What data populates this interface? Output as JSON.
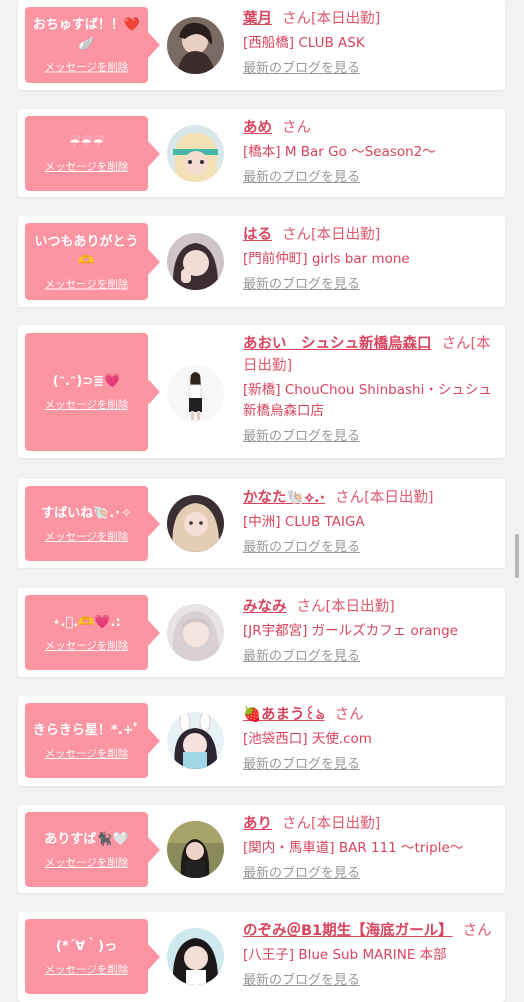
{
  "colors": {
    "accent": "#fc94a2",
    "name": "#d9445e",
    "link_gray": "#999999",
    "background": "#f2f2f2"
  },
  "delete_label": "メッセージを削除",
  "blog_label": "最新のブログを見る",
  "san_label": "さん",
  "cards": [
    {
      "message": "おちゅすば！！❤️🪽",
      "name": "葉月",
      "suffix": "[本日出勤]",
      "store": "[西船橋] CLUB ASK",
      "avatar_icon": "photo-avatar"
    },
    {
      "message": "☔☔☔",
      "name": "あめ",
      "suffix": "",
      "store": "[橋本] M Bar Go 〜Season2〜",
      "avatar_icon": "photo-avatar"
    },
    {
      "message": "いつもありがとう🫶",
      "name": "はる",
      "suffix": "[本日出勤]",
      "store": "[門前仲町] girls bar mone",
      "avatar_icon": "photo-avatar"
    },
    {
      "message": "(ᵔ.ᵔ)⊃≣💗",
      "name": "あおい　シュシュ新橋烏森口",
      "suffix": "[本日出勤]",
      "store": "[新橋] ChouChou Shinbashi・シュシュ新橋烏森口店",
      "avatar_icon": "photo-avatar"
    },
    {
      "message": "すばいね🐚.･✧",
      "name": "かなた🐚⟡.·",
      "suffix": "[本日出勤]",
      "store": "[中洲] CLUB TAIGA",
      "avatar_icon": "photo-avatar"
    },
    {
      "message": "⋆.ﾟ.🫶💗.:",
      "name": "みなみ",
      "suffix": "[本日出勤]",
      "store": "[JR宇都宮] ガールズカフェ orange",
      "avatar_icon": "photo-avatar"
    },
    {
      "message": "きらきら星！*.+ﾟ",
      "name": "🍓あまう꒰ঌ",
      "suffix": "",
      "store": "[池袋西口] 天使.com",
      "avatar_icon": "photo-avatar"
    },
    {
      "message": "ありすば🐈‍⬛🤍",
      "name": "あり",
      "suffix": "[本日出勤]",
      "store": "[関内・馬車道] BAR 111 〜triple〜",
      "avatar_icon": "photo-avatar"
    },
    {
      "message": "(*´∀｀)っ",
      "name": "のぞみ＠B1期生【海底ガール】",
      "suffix": "",
      "store": "[八王子] Blue Sub MARINE 本部",
      "avatar_icon": "photo-avatar"
    }
  ]
}
